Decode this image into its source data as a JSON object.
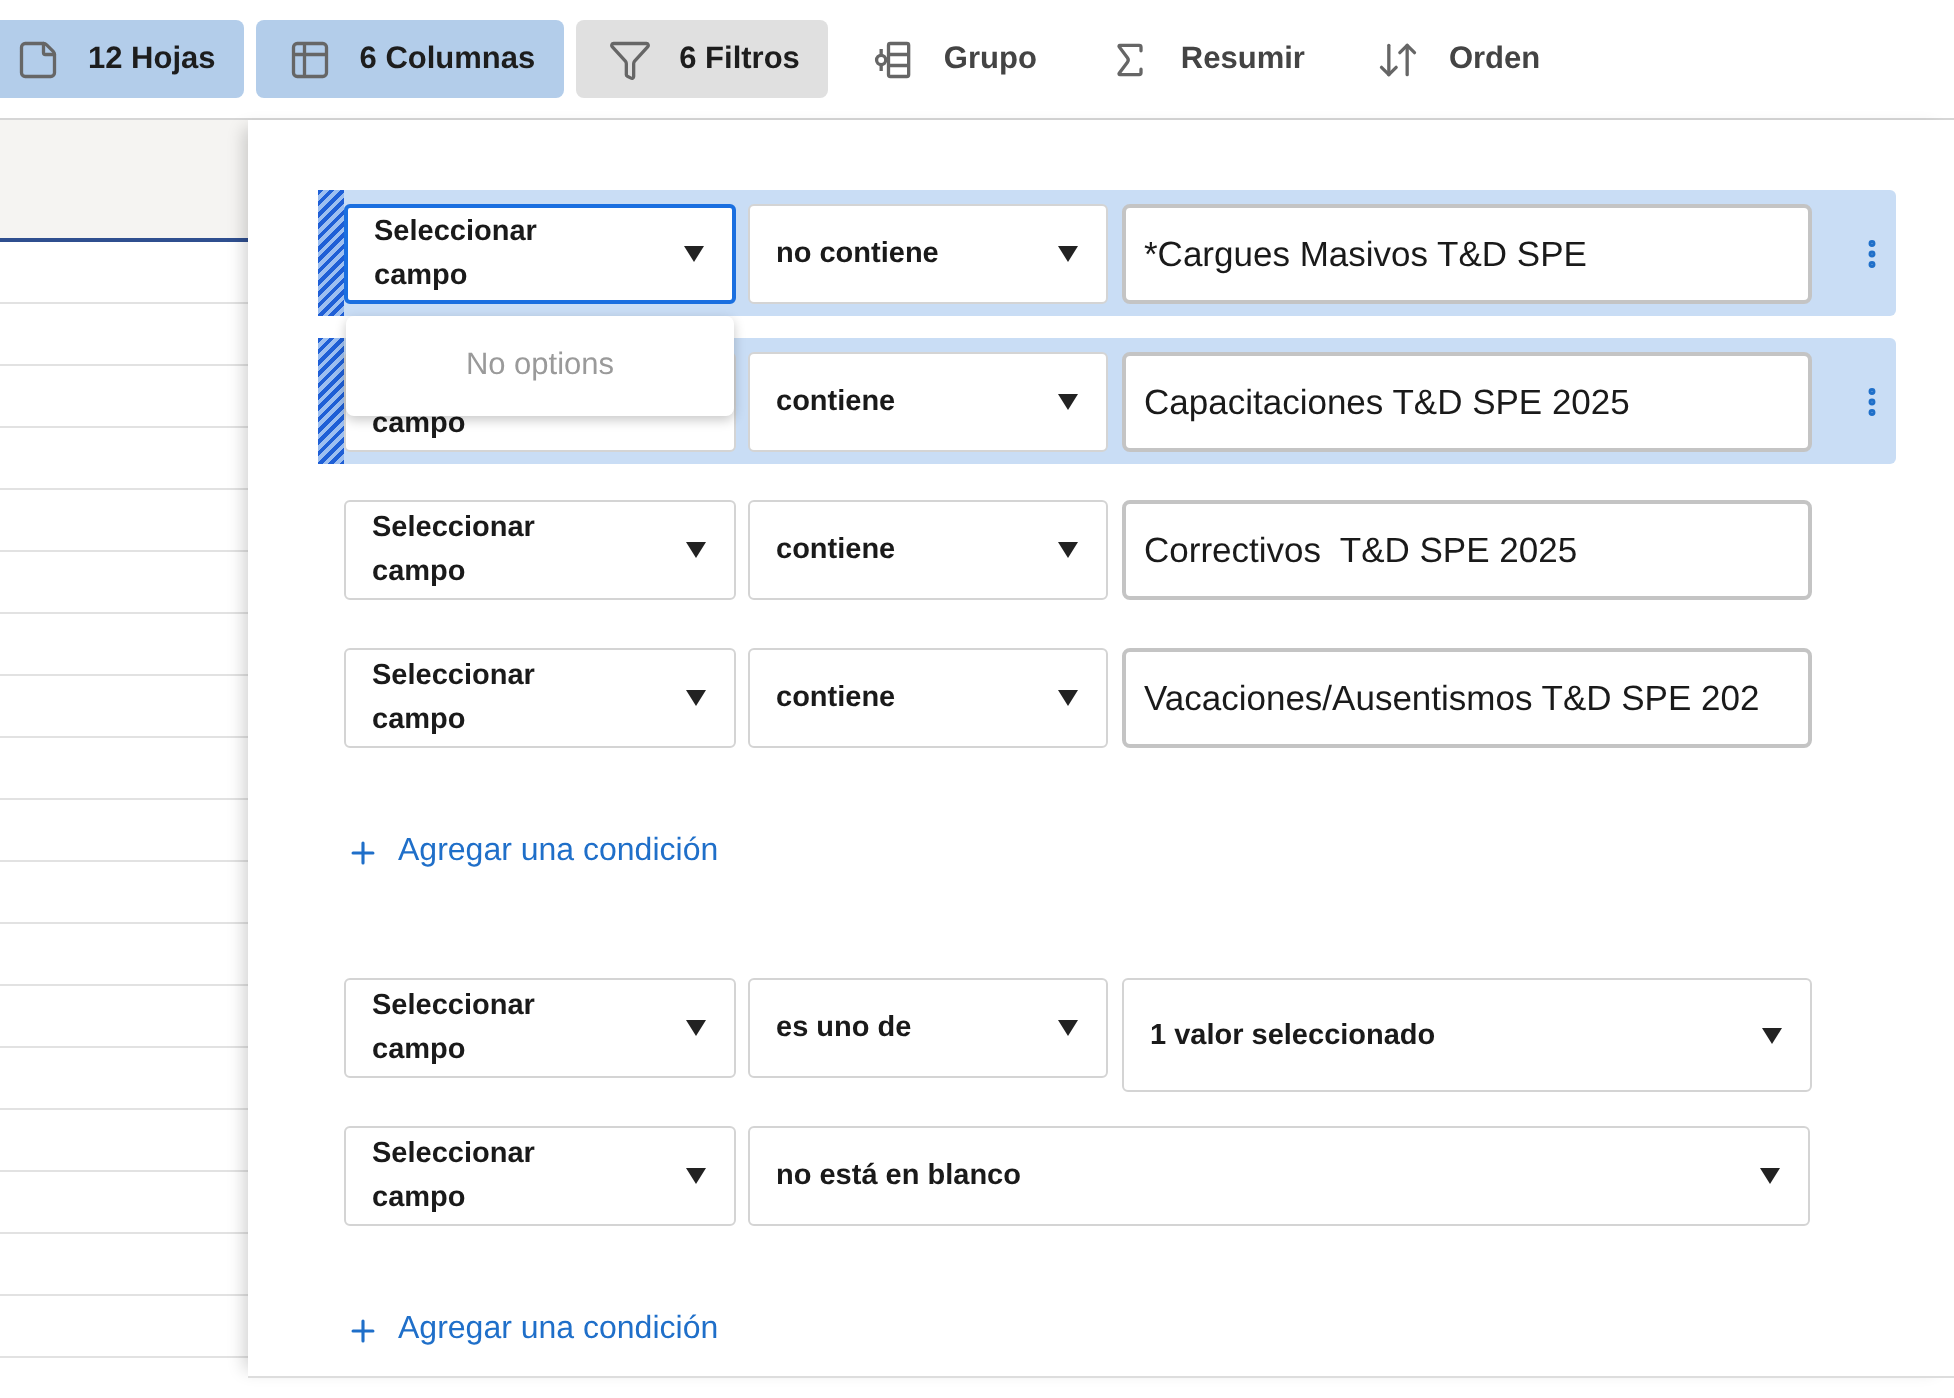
{
  "toolbar": [
    {
      "label": "12 Hojas",
      "kind": "applied"
    },
    {
      "label": "6 Columnas",
      "kind": "applied"
    },
    {
      "label": "6 Filtros",
      "kind": "open"
    },
    {
      "label": "Grupo",
      "kind": "plain"
    },
    {
      "label": "Resumir",
      "kind": "plain"
    },
    {
      "label": "Orden",
      "kind": "plain"
    }
  ],
  "filter_groups": [
    {
      "conditions": [
        {
          "field": "Seleccionar campo",
          "field_menu": {
            "open": true,
            "message": "No options"
          },
          "operator": "no contiene",
          "kind": "text",
          "value": "*Cargues Masivos T&D SPE",
          "selected": true
        },
        {
          "field": "campo",
          "operator": "contiene",
          "kind": "text",
          "value": "Capacitaciones T&D SPE 2025",
          "selected": true
        },
        {
          "field": "Seleccionar campo",
          "operator": "contiene",
          "kind": "text",
          "value": "Correctivos  T&D SPE 2025",
          "selected": false
        },
        {
          "field": "Seleccionar campo",
          "operator": "contiene",
          "kind": "text",
          "value": "Vacaciones/Ausentismos T&D SPE 202",
          "selected": false
        }
      ],
      "add_label": "Agregar una condición"
    },
    {
      "conditions": [
        {
          "field": "Seleccionar campo",
          "operator": "es uno de",
          "kind": "select",
          "value": "1 valor seleccionado",
          "selected": false
        },
        {
          "field": "Seleccionar campo",
          "operator": "no está en blanco",
          "kind": "no_value",
          "selected": false
        }
      ],
      "add_label": "Agregar una condición"
    }
  ]
}
